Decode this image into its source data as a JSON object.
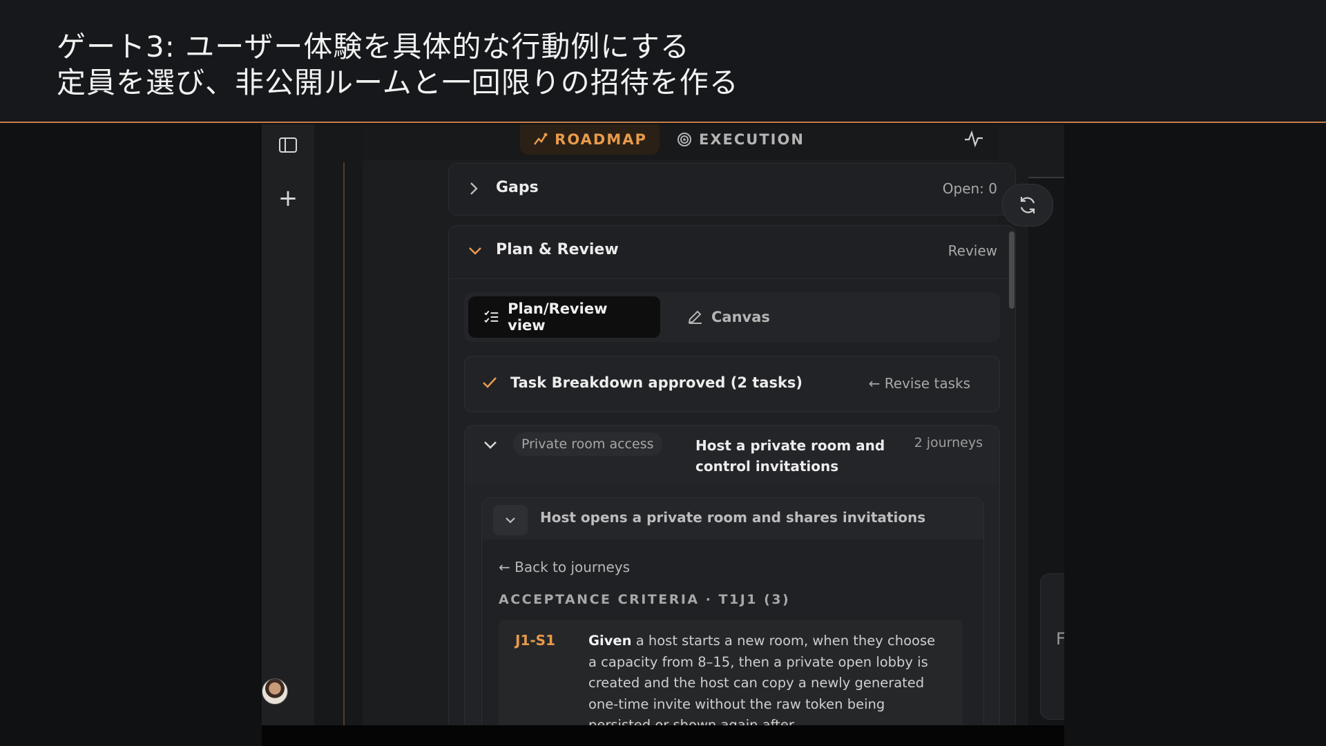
{
  "banner": {
    "line1": "ゲート3: ユーザー体験を具体的な行動例にする",
    "line2": "定員を選び、非公開ルームと一回限りの招待を作る"
  },
  "nav": {
    "tabs": [
      {
        "label": "ROADMAP",
        "icon": "roadmap-icon",
        "active": true
      },
      {
        "label": "EXECUTION",
        "icon": "target-icon",
        "active": false
      }
    ],
    "activity_icon": "pulse-icon"
  },
  "gaps": {
    "title": "Gaps",
    "status": "Open: 0"
  },
  "plan": {
    "title": "Plan & Review",
    "status": "Review",
    "view_toggle": {
      "active": "Plan/Review view",
      "other": "Canvas"
    },
    "approved": {
      "text": "Task Breakdown approved (2 tasks)",
      "revise": "← Revise tasks"
    },
    "feature": {
      "pill": "Private room access",
      "title": "Host a private room and control invitations",
      "count": "2 journeys",
      "journey": {
        "title": "Host opens a private room and shares invitations",
        "back": "← Back to journeys",
        "ac_title": "ACCEPTANCE CRITERIA · T1J1 (3)",
        "criteria": [
          {
            "id": "J1-S1",
            "lead": "Given",
            "text": "a host starts a new room, when they choose a capacity from 8–15, then a private open lobby is created and the host can copy a newly generated one-time invite without the raw token being persisted or shown again after"
          }
        ]
      }
    }
  },
  "rightcard": {
    "text": "F"
  },
  "colors": {
    "accent": "#e89a4c",
    "banner_rule": "#c97e4a",
    "background": "#1c1d1f"
  }
}
